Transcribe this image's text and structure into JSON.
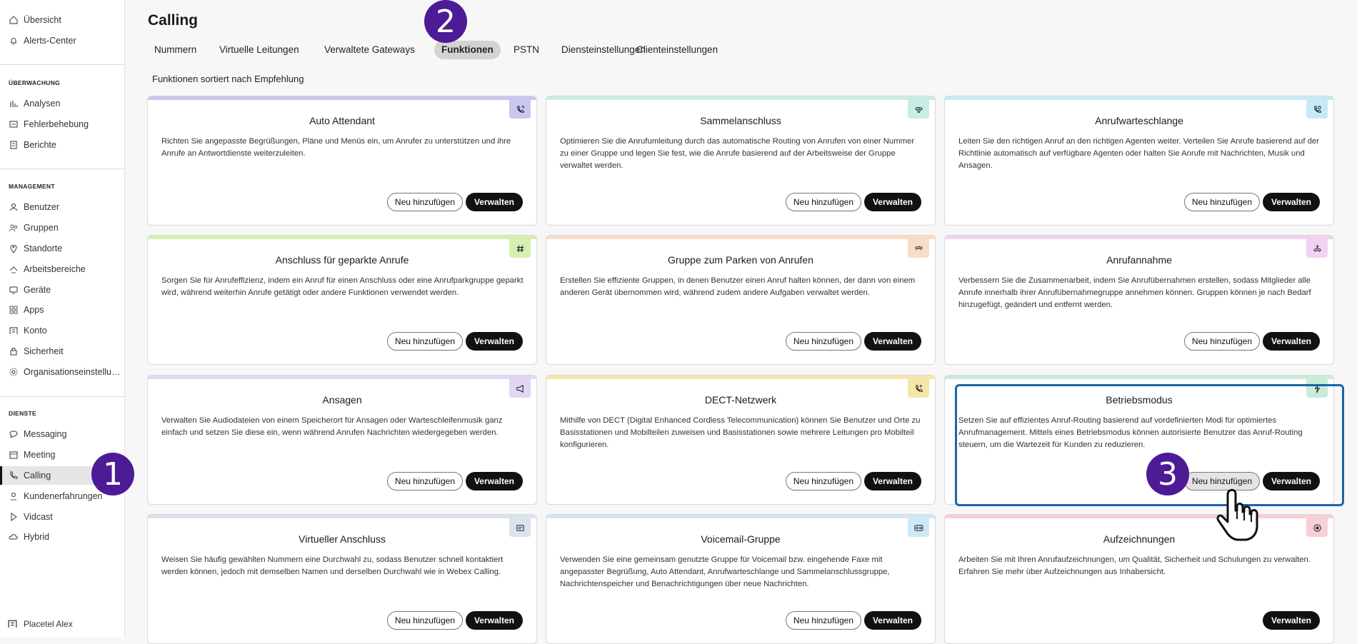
{
  "sidebar": {
    "top_items": [
      {
        "label": "Übersicht",
        "icon": "home-icon"
      },
      {
        "label": "Alerts-Center",
        "icon": "bell-icon"
      }
    ],
    "sections": [
      {
        "heading": "ÜBERWACHUNG",
        "items": [
          {
            "label": "Analysen",
            "icon": "chart-icon"
          },
          {
            "label": "Fehlerbehebung",
            "icon": "troubleshoot-icon"
          },
          {
            "label": "Berichte",
            "icon": "report-icon"
          }
        ]
      },
      {
        "heading": "MANAGEMENT",
        "items": [
          {
            "label": "Benutzer",
            "icon": "user-icon"
          },
          {
            "label": "Gruppen",
            "icon": "group-icon"
          },
          {
            "label": "Standorte",
            "icon": "location-icon"
          },
          {
            "label": "Arbeitsbereiche",
            "icon": "workspace-icon"
          },
          {
            "label": "Geräte",
            "icon": "device-icon"
          },
          {
            "label": "Apps",
            "icon": "apps-icon"
          },
          {
            "label": "Konto",
            "icon": "account-icon"
          },
          {
            "label": "Sicherheit",
            "icon": "lock-icon"
          },
          {
            "label": "Organisationseinstellungen",
            "icon": "gear-icon"
          }
        ]
      },
      {
        "heading": "DIENSTE",
        "items": [
          {
            "label": "Messaging",
            "icon": "message-icon"
          },
          {
            "label": "Meeting",
            "icon": "calendar-icon"
          },
          {
            "label": "Calling",
            "icon": "phone-icon",
            "active": true
          },
          {
            "label": "Kundenerfahrungen",
            "icon": "customer-icon"
          },
          {
            "label": "Vidcast",
            "icon": "play-icon"
          },
          {
            "label": "Hybrid",
            "icon": "cloud-icon"
          }
        ]
      }
    ],
    "footer_user": "Placetel Alex"
  },
  "header": {
    "title": "Calling",
    "tabs": [
      "Nummern",
      "Virtuelle Leitungen",
      "Verwaltete Gateways",
      "Funktionen",
      "PSTN",
      "Diensteinstellungen",
      "Clienteinstellungen"
    ],
    "active_tab": "Funktionen"
  },
  "main": {
    "subheading": "Funktionen sortiert nach Empfehlung",
    "add_label": "Neu hinzufügen",
    "manage_label": "Verwalten",
    "cards": [
      {
        "title": "Auto Attendant",
        "desc": "Richten Sie angepasste Begrüßungen, Pläne und Menüs ein, um Anrufer zu unterstützen und ihre Anrufe an Antwortdienste weiterzuleiten.",
        "accent": "#c9c6ef",
        "icon": "phone-menu-icon"
      },
      {
        "title": "Sammelanschluss",
        "desc": "Optimieren Sie die Anrufumleitung durch das automatische Routing von Anrufen von einer Nummer zu einer Gruppe und legen Sie fest, wie die Anrufe basierend auf der Arbeitsweise der Gruppe verwaltet werden.",
        "accent": "#c8ede4",
        "icon": "hunt-group-icon"
      },
      {
        "title": "Anrufwarteschlange",
        "desc": "Leiten Sie den richtigen Anruf an den richtigen Agenten weiter. Verteilen Sie Anrufe basierend auf der Richtlinie automatisch auf verfügbare Agenten oder halten Sie Anrufe mit Nachrichten, Musik und Ansagen.",
        "accent": "#c6e9f5",
        "icon": "call-queue-icon"
      },
      {
        "title": "Anschluss für geparkte Anrufe",
        "desc": "Sorgen Sie für Anrufeffizienz, indem ein Anruf für einen Anschluss oder eine Anrufparkgruppe geparkt wird, während weiterhin Anrufe getätigt oder andere Funktionen verwendet werden.",
        "accent": "#d6efb0",
        "icon": "hash-icon"
      },
      {
        "title": "Gruppe zum Parken von Anrufen",
        "desc": "Erstellen Sie effiziente Gruppen, in denen Benutzer einen Anruf halten können, der dann von einem anderen Gerät übernommen wird, während zudem andere Aufgaben verwaltet werden.",
        "accent": "#f8dcc8",
        "icon": "call-park-icon"
      },
      {
        "title": "Anrufannahme",
        "desc": "Verbessern Sie die Zusammenarbeit, indem Sie Anrufübernahmen erstellen, sodass Mitglieder alle Anrufe innerhalb ihrer Anrufübernahmegruppe annehmen können. Gruppen können je nach Bedarf hinzugefügt, geändert und entfernt werden.",
        "accent": "#f2d2f0",
        "icon": "call-pickup-icon"
      },
      {
        "title": "Ansagen",
        "desc": "Verwalten Sie Audiodateien von einem Speicherort für Ansagen oder Warteschleifenmusik ganz einfach und setzen Sie diese ein, wenn während Anrufen Nachrichten wiedergegeben werden.",
        "accent": "#e1d6f4",
        "icon": "megaphone-icon"
      },
      {
        "title": "DECT-Netzwerk",
        "desc": "Mithilfe von DECT (Digital Enhanced Cordless Telecommunication) können Sie Benutzer und Orte zu Basisstationen und Mobilteilen zuweisen und Basisstationen sowie mehrere Leitungen pro Mobilteil konfigurieren.",
        "accent": "#f3e6a8",
        "icon": "dect-icon"
      },
      {
        "title": "Betriebsmodus",
        "desc": "Setzen Sie auf effizientes Anruf-Routing basierend auf vordefinierten Modi für optimiertes Anrufmanagement. Mittels eines Betriebsmodus können autorisierte Benutzer das Anruf-Routing steuern, um die Wartezeit für Kunden zu reduzieren.",
        "accent": "#c8ecd8",
        "icon": "operating-mode-icon"
      },
      {
        "title": "Virtueller Anschluss",
        "desc": "Weisen Sie häufig gewählten Nummern eine Durchwahl zu, sodass Benutzer schnell kontaktiert werden können, jedoch mit demselben Namen und derselben Durchwahl wie in Webex Calling.",
        "accent": "#dbe3ef",
        "icon": "virtual-line-icon"
      },
      {
        "title": "Voicemail-Gruppe",
        "desc": "Verwenden Sie eine gemeinsam genutzte Gruppe für Voicemail bzw. eingehende Faxe mit angepasster Begrüßung, Auto Attendant, Anrufwarteschlange und Sammelanschlussgruppe, Nachrichtenspeicher und Benachrichtigungen über neue Nachrichten.",
        "accent": "#cde9f6",
        "icon": "voicemail-icon"
      },
      {
        "title": "Aufzeichnungen",
        "desc": "Arbeiten Sie mit Ihren Anrufaufzeichnungen, um Qualität, Sicherheit und Schulungen zu verwalten. Erfahren Sie mehr über Aufzeichnungen aus Inhabersicht.",
        "accent": "#f6d0d6",
        "icon": "record-icon",
        "no_add": true
      }
    ]
  },
  "annotations": {
    "markers": [
      "1",
      "2",
      "3"
    ]
  }
}
